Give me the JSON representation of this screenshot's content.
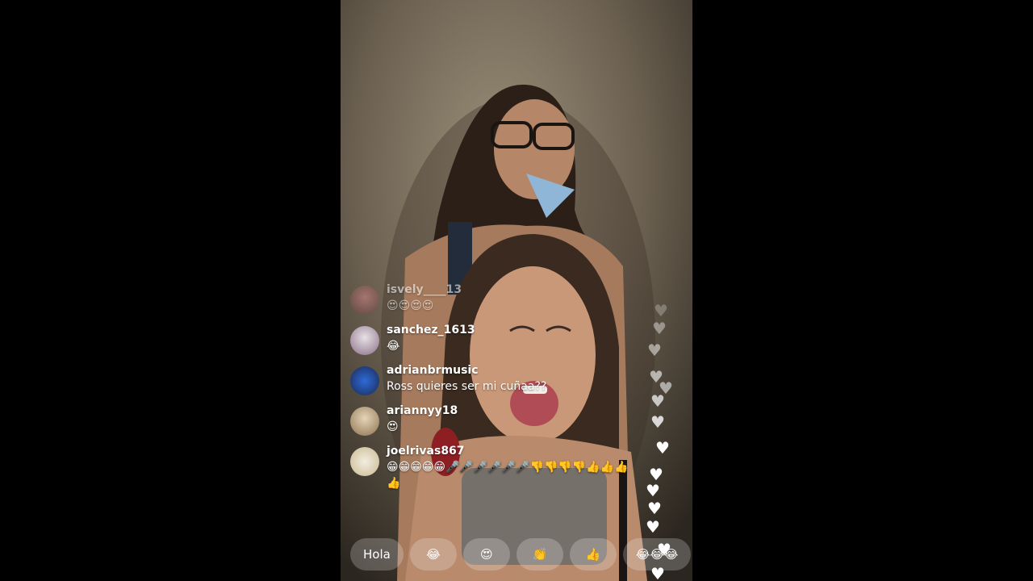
{
  "comments": [
    {
      "user": "isvely____13",
      "message": "😍😍😍😍",
      "faded": true
    },
    {
      "user": "sanchez_1613",
      "message": "😂"
    },
    {
      "user": "adrianbrmusic",
      "message": "Ross quieres ser mi cuñaa??"
    },
    {
      "user": "ariannyy18",
      "message": "😍"
    },
    {
      "user": "joelrivas867",
      "message": "😁😁😁😁😁🎤🎤🎤🎤🎤🎤👎👎👎👎👍👍👍👍"
    }
  ],
  "quick_replies": [
    "Hola",
    "😂",
    "😍",
    "👏",
    "👍",
    "😂😂😂"
  ],
  "colors": {
    "background": "#000000",
    "text": "#ffffff"
  }
}
